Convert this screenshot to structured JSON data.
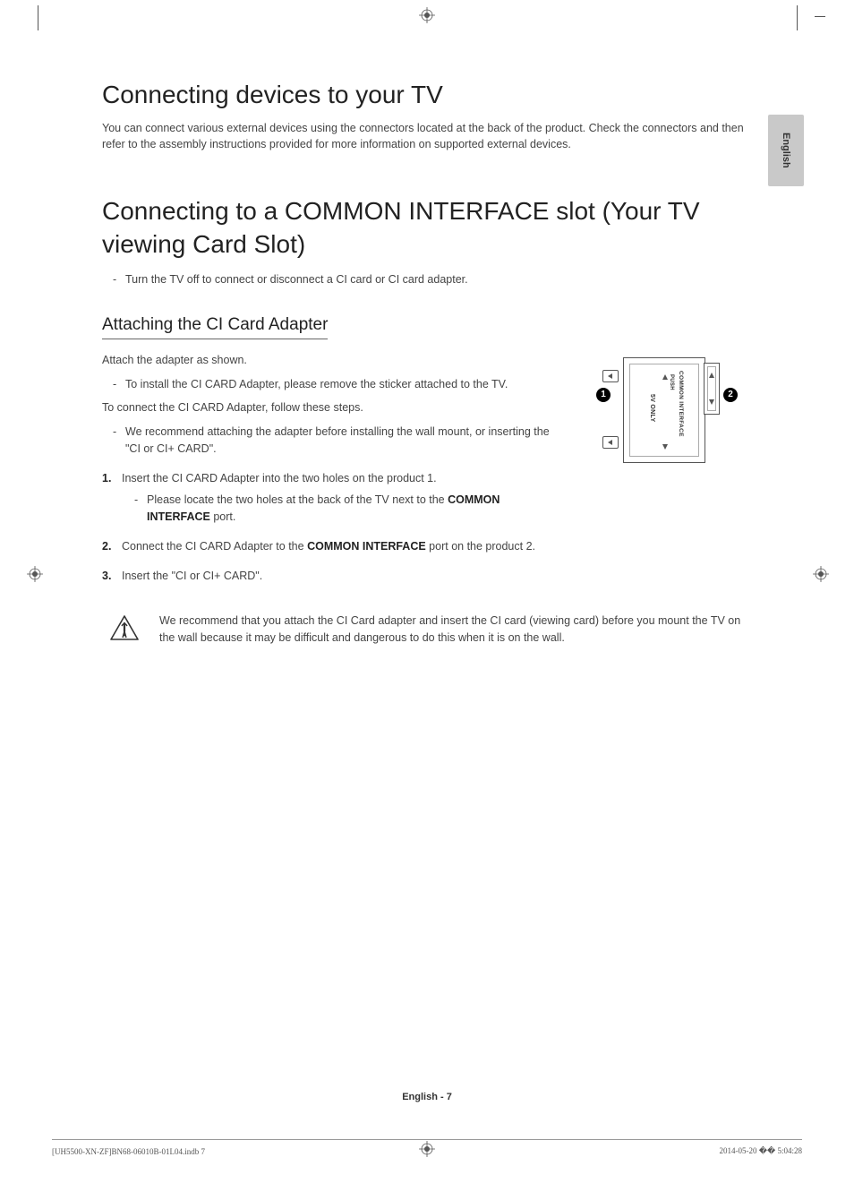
{
  "lang_tab": "English",
  "h1a": "Connecting devices to your TV",
  "intro": "You can connect various external devices using the connectors located at the back of the product. Check the connectors and then refer to the assembly instructions provided for more information on supported external devices.",
  "h1b": "Connecting to a COMMON INTERFACE slot (Your TV viewing Card Slot)",
  "note1": "Turn the TV off to connect or disconnect a CI card or CI card adapter.",
  "h2": "Attaching the CI Card Adapter",
  "p1": "Attach the adapter as shown.",
  "p1_sub": "To install the CI CARD Adapter, please remove the sticker attached to the TV.",
  "p2": "To connect the CI CARD Adapter, follow these steps.",
  "p2_sub": "We recommend attaching the adapter before installing the wall mount, or inserting the \"CI or CI+ CARD\".",
  "steps": {
    "s1_num": "1.",
    "s1": "Insert the CI CARD Adapter into the two holes on the product 1.",
    "s1_sub_a": "Please locate the two holes at the back of the TV next to the ",
    "s1_sub_bold": "COMMON INTERFACE",
    "s1_sub_b": " port.",
    "s2_num": "2.",
    "s2_a": "Connect the CI CARD Adapter to the ",
    "s2_bold": "COMMON INTERFACE",
    "s2_b": " port on the product 2.",
    "s3_num": "3.",
    "s3": "Insert the \"CI or CI+ CARD\"."
  },
  "warn": "We recommend that you attach the CI Card adapter and insert the CI card (viewing card) before you mount the TV on the wall because it may be difficult and dangerous to do this when it is on the wall.",
  "diagram": {
    "label_ci": "COMMON INTERFACE",
    "label_push": "PUSH",
    "label_sv": "5V ONLY",
    "badge1": "1",
    "badge2": "2"
  },
  "footer_center": "English - 7",
  "footer_left": "[UH5500-XN-ZF]BN68-06010B-01L04.indb   7",
  "footer_right": "2014-05-20   �� 5:04:28"
}
